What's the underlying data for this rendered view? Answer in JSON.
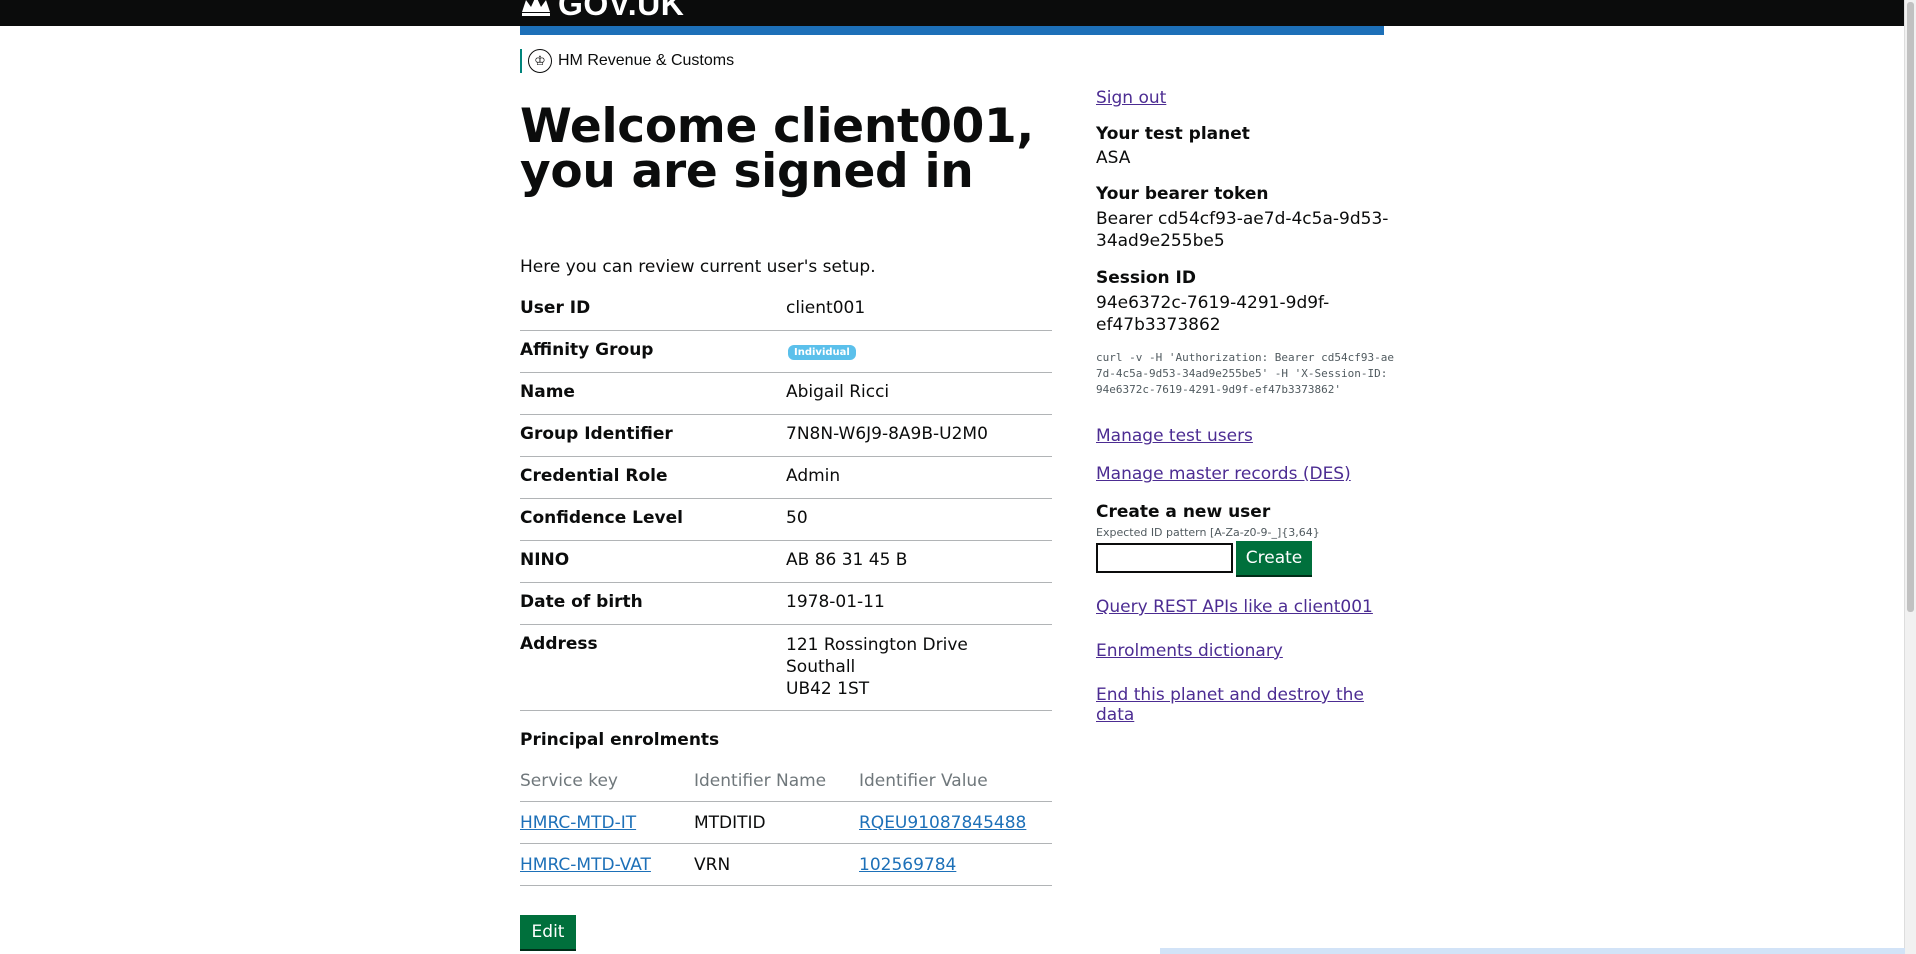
{
  "header": {
    "brand": "GOV.UK",
    "department": "HM Revenue & Customs"
  },
  "main": {
    "title": "Welcome client001, you are signed in",
    "intro": "Here you can review current user's setup.",
    "rows": [
      {
        "key": "User ID",
        "value": "client001"
      },
      {
        "key": "Affinity Group",
        "value": "Individual"
      },
      {
        "key": "Name",
        "value": "Abigail Ricci"
      },
      {
        "key": "Group Identifier",
        "value": "7N8N-W6J9-8A9B-U2M0"
      },
      {
        "key": "Credential Role",
        "value": "Admin"
      },
      {
        "key": "Confidence Level",
        "value": "50"
      },
      {
        "key": "NINO",
        "value": "AB 86 31 45 B"
      },
      {
        "key": "Date of birth",
        "value": "1978-01-11"
      },
      {
        "key": "Address",
        "lines": [
          "121 Rossington Drive",
          "Southall",
          "UB42 1ST"
        ]
      }
    ],
    "enrolments": {
      "title": "Principal enrolments",
      "headers": [
        "Service key",
        "Identifier Name",
        "Identifier Value"
      ],
      "rows": [
        {
          "service": "HMRC-MTD-IT",
          "name": "MTDITID",
          "value": "RQEU91087845488"
        },
        {
          "service": "HMRC-MTD-VAT",
          "name": "VRN",
          "value": "102569784"
        }
      ]
    },
    "edit_label": "Edit"
  },
  "side": {
    "sign_out": "Sign out",
    "planet_label": "Your test planet",
    "planet": "ASA",
    "token_label": "Your bearer token",
    "token": "Bearer cd54cf93-ae7d-4c5a-9d53-34ad9e255be5",
    "session_label": "Session ID",
    "session": "94e6372c-7619-4291-9d9f-ef47b3373862",
    "curl": "curl -v -H 'Authorization: Bearer cd54cf93-ae7d-4c5a-9d53-34ad9e255be5' -H 'X-Session-ID: 94e6372c-7619-4291-9d9f-ef47b3373862'",
    "manage_users": "Manage test users",
    "manage_records": "Manage master records (DES)",
    "create_label": "Create a new user",
    "create_hint": "Expected ID pattern [A-Za-z0-9-_]{3,64}",
    "create_value": "",
    "create_button": "Create",
    "query_apis": "Query REST APIs like a client001",
    "enrolments_dict": "Enrolments dictionary",
    "end_planet": "End this planet and destroy the data"
  },
  "colors": {
    "brand_blue": "#1d70b8",
    "button_green": "#00703c",
    "tag_blue": "#5bc0eb",
    "visited_link": "#4c2c92"
  }
}
